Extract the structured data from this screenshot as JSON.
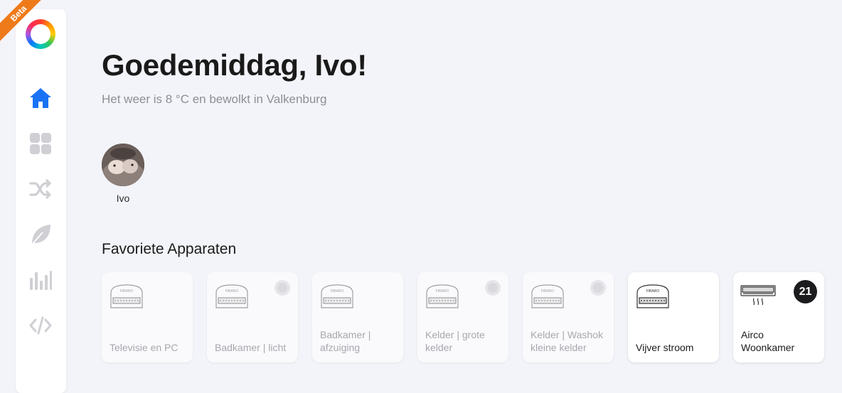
{
  "sidebar": {
    "beta_label": "Beta",
    "logo": "homey-logo",
    "items": [
      {
        "icon": "home-icon",
        "active": true
      },
      {
        "icon": "devices-grid-icon",
        "active": false
      },
      {
        "icon": "flows-shuffle-icon",
        "active": false
      },
      {
        "icon": "energy-leaf-icon",
        "active": false
      },
      {
        "icon": "insights-chart-icon",
        "active": false
      },
      {
        "icon": "developer-code-icon",
        "active": false
      }
    ]
  },
  "header": {
    "greeting": "Goedemiddag, Ivo!",
    "weather": "Het weer is 8 °C en bewolkt in Valkenburg"
  },
  "users": [
    {
      "name": "Ivo"
    }
  ],
  "favorites": {
    "title": "Favoriete Apparaten",
    "devices": [
      {
        "label": "Televisie en PC",
        "icon": "relay-module-icon",
        "active": false,
        "toggle": false
      },
      {
        "label": "Badkamer | licht",
        "icon": "relay-module-icon",
        "active": false,
        "toggle": true
      },
      {
        "label": "Badkamer | afzuiging",
        "icon": "relay-module-icon",
        "active": false,
        "toggle": false
      },
      {
        "label": "Kelder | grote kelder",
        "icon": "relay-module-icon",
        "active": false,
        "toggle": true
      },
      {
        "label": "Kelder | Washok kleine kelder",
        "icon": "relay-module-icon",
        "active": false,
        "toggle": true
      },
      {
        "label": "Vijver stroom",
        "icon": "relay-module-icon",
        "active": true,
        "toggle": false
      },
      {
        "label": "Airco Woonkamer",
        "icon": "aircon-icon",
        "active": true,
        "temperature": "21"
      }
    ]
  },
  "colors": {
    "accent": "#1a73f5",
    "beta": "#ef7a1a",
    "background": "#f3f4f9"
  }
}
